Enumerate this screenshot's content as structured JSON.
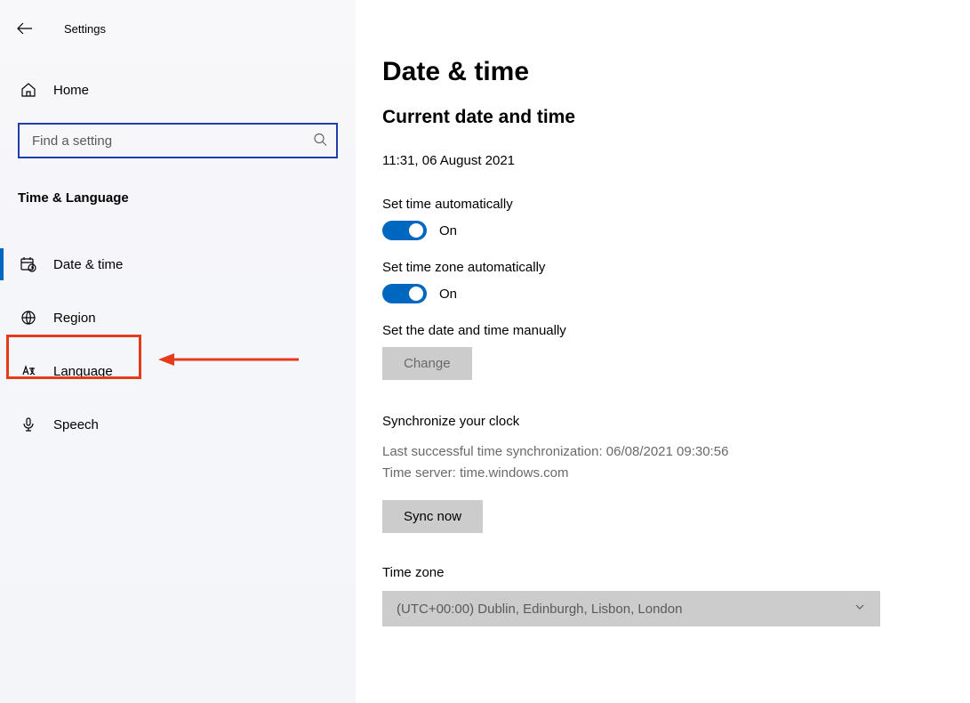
{
  "header": {
    "title": "Settings"
  },
  "sidebar": {
    "home_label": "Home",
    "search_placeholder": "Find a setting",
    "category": "Time & Language",
    "items": [
      {
        "label": "Date & time",
        "active": true
      },
      {
        "label": "Region",
        "active": false
      },
      {
        "label": "Language",
        "active": false
      },
      {
        "label": "Speech",
        "active": false
      }
    ]
  },
  "main": {
    "title": "Date & time",
    "current_section": "Current date and time",
    "current_value": "11:31, 06 August 2021",
    "set_time_auto": {
      "label": "Set time automatically",
      "state": "On"
    },
    "set_tz_auto": {
      "label": "Set time zone automatically",
      "state": "On"
    },
    "manual": {
      "label": "Set the date and time manually",
      "button": "Change"
    },
    "sync": {
      "heading": "Synchronize your clock",
      "last": "Last successful time synchronization: 06/08/2021 09:30:56",
      "server": "Time server: time.windows.com",
      "button": "Sync now"
    },
    "timezone": {
      "label": "Time zone",
      "value": "(UTC+00:00) Dublin, Edinburgh, Lisbon, London"
    }
  },
  "colors": {
    "accent": "#0067c0",
    "highlight": "#e53a1c"
  }
}
